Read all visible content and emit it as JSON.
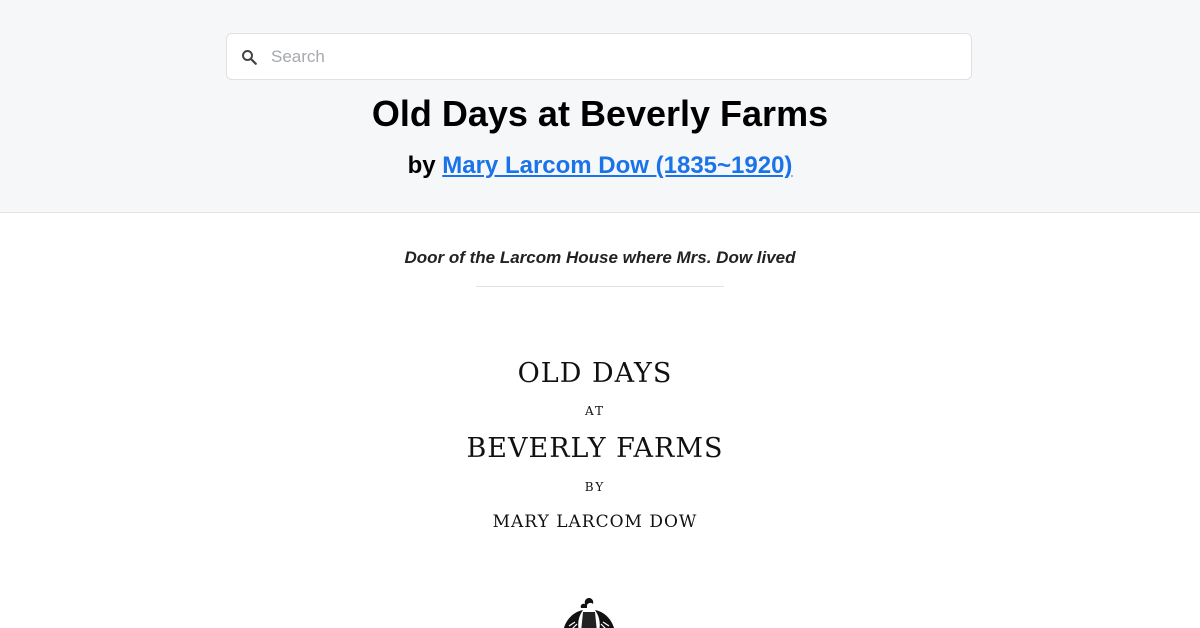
{
  "search": {
    "placeholder": "Search",
    "icon": "search-icon"
  },
  "book": {
    "title": "Old Days at Beverly Farms",
    "by_prefix": "by",
    "author_link": "Mary Larcom Dow (1835~1920)"
  },
  "figure": {
    "caption": "Door of the Larcom House where Mrs. Dow lived"
  },
  "title_page": {
    "line1": "OLD DAYS",
    "line2": "AT",
    "line3": "BEVERLY FARMS",
    "line4": "BY",
    "line5": "MARY LARCOM DOW",
    "emblem": "eagle-emblem-icon"
  },
  "colors": {
    "header_bg": "#f6f7f9",
    "link": "#1a73e8"
  }
}
